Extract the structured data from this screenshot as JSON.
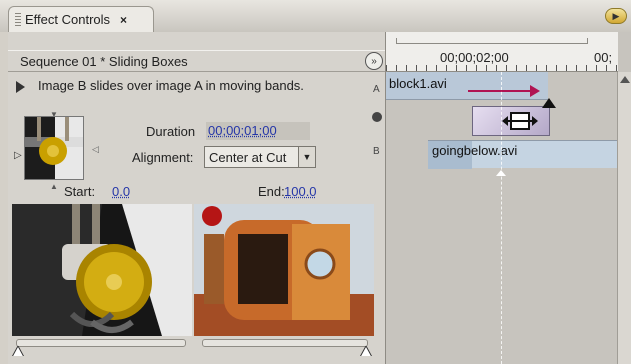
{
  "tab": {
    "label": "Effect Controls",
    "close": "×"
  },
  "header": {
    "sequence_title": "Sequence 01 * Sliding Boxes",
    "show_hide": "»"
  },
  "effect": {
    "description": "Image B slides over image A in moving bands.",
    "duration_label": "Duration",
    "duration_value": "00;00;01;00",
    "alignment_label": "Alignment:",
    "alignment_value": "Center at Cut",
    "start_label": "Start:",
    "start_value": "0.0",
    "end_label": "End:",
    "end_value": "100.0"
  },
  "timeline": {
    "ruler_time": "00;00;02;00",
    "ruler_time_partial": "00;",
    "track_a_label": "A",
    "track_b_label": "B",
    "clip_a": "block1.avi",
    "clip_b": "goingbelow.avi"
  },
  "colors": {
    "accent_arrow": "#b01452",
    "value_link": "#2536a8",
    "flyout": "#d2a832"
  },
  "icons": [
    "grip-icon",
    "close-icon",
    "panel-menu-icon",
    "show-hide-icon",
    "play-icon",
    "dropdown-icon",
    "resize-cursor-icon",
    "scroll-up-icon"
  ]
}
